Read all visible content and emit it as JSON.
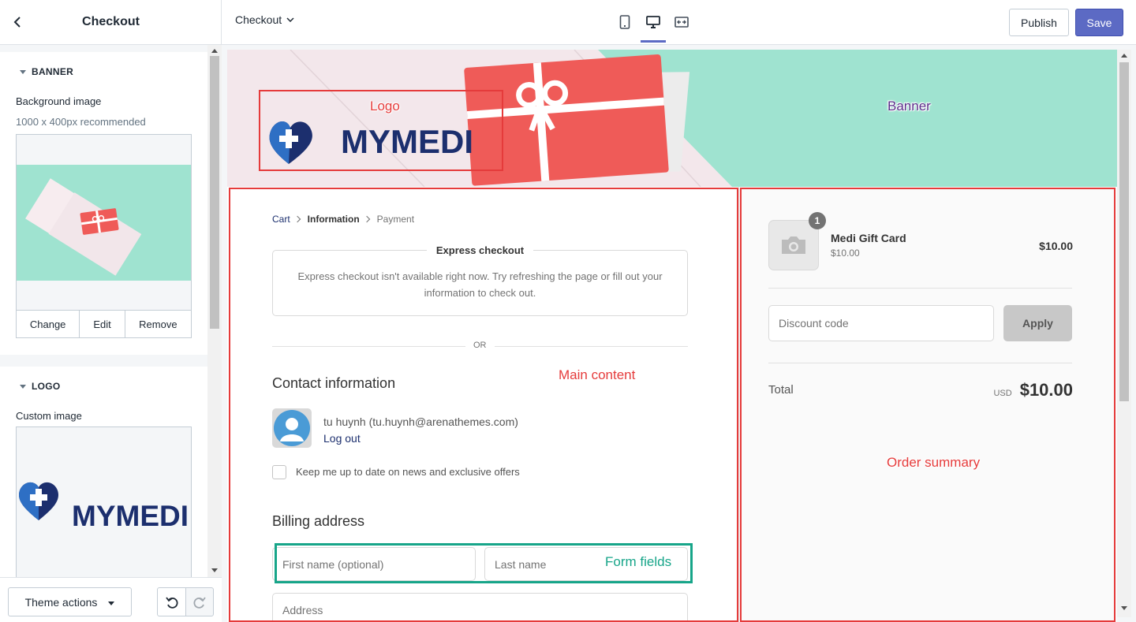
{
  "sidebar": {
    "title": "Checkout",
    "banner_section": {
      "heading": "BANNER",
      "field_label": "Background image",
      "hint": "1000 x 400px recommended",
      "buttons": {
        "change": "Change",
        "edit": "Edit",
        "remove": "Remove"
      }
    },
    "logo_section": {
      "heading": "LOGO",
      "field_label": "Custom image",
      "logo_text": "MYMEDI"
    },
    "footer": {
      "theme_actions": "Theme actions"
    }
  },
  "topbar": {
    "page_select": "Checkout",
    "device_icons": [
      "mobile-icon",
      "desktop-icon",
      "fullscreen-icon"
    ],
    "publish": "Publish",
    "save": "Save"
  },
  "preview": {
    "logo_text": "MYMEDI",
    "breadcrumb": {
      "cart": "Cart",
      "information": "Information",
      "payment": "Payment"
    },
    "express": {
      "title": "Express checkout",
      "message": "Express checkout isn't available right now. Try refreshing the page or fill out your information to check out."
    },
    "divider": "OR",
    "contact": {
      "heading": "Contact information",
      "user": "tu huynh (tu.huynh@arenathemes.com)",
      "logout": "Log out",
      "newsletter": "Keep me up to date on news and exclusive offers"
    },
    "billing": {
      "heading": "Billing address",
      "first_name": "First name (optional)",
      "last_name": "Last name",
      "address": "Address"
    },
    "summary": {
      "quantity": "1",
      "product_name": "Medi Gift Card",
      "product_variant_price": "$10.00",
      "product_price": "$10.00",
      "discount_placeholder": "Discount code",
      "apply": "Apply",
      "total_label": "Total",
      "currency": "USD",
      "total": "$10.00"
    }
  },
  "annotations": {
    "logo": "Logo",
    "banner": "Banner",
    "main_content": "Main content",
    "order_summary": "Order summary",
    "form_fields": "Form fields"
  },
  "colors": {
    "accent": "#5c6ac4",
    "banner_bg": "#9fe3d0",
    "brand_navy": "#1c2f6e",
    "brand_blue": "#2e6fc4",
    "gift_red": "#ef5b58",
    "annotation_red": "#e53b3b",
    "annotation_purple": "#5a2d8a",
    "annotation_teal": "#17a589"
  }
}
